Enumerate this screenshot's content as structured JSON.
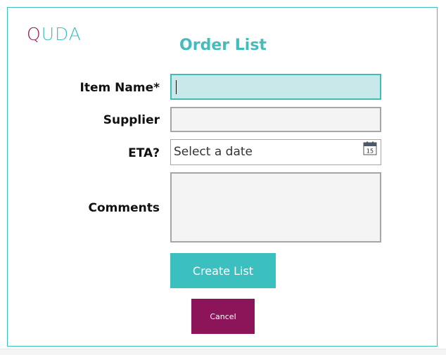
{
  "logo": {
    "first_letter": "Q",
    "rest": "UDA"
  },
  "title": "Order List",
  "form": {
    "item_name": {
      "label": "Item Name*",
      "value": ""
    },
    "supplier": {
      "label": "Supplier",
      "value": ""
    },
    "eta": {
      "label": "ETA?",
      "placeholder": "Select a date",
      "icon": "calendar-icon",
      "icon_day": "15"
    },
    "comments": {
      "label": "Comments",
      "value": ""
    }
  },
  "buttons": {
    "create": "Create List",
    "cancel": "Cancel"
  },
  "colors": {
    "accent": "#3bbfbf",
    "brand_secondary": "#8c1458",
    "focused_field_bg": "#c8e8ea",
    "field_bg": "#f4f4f4"
  }
}
